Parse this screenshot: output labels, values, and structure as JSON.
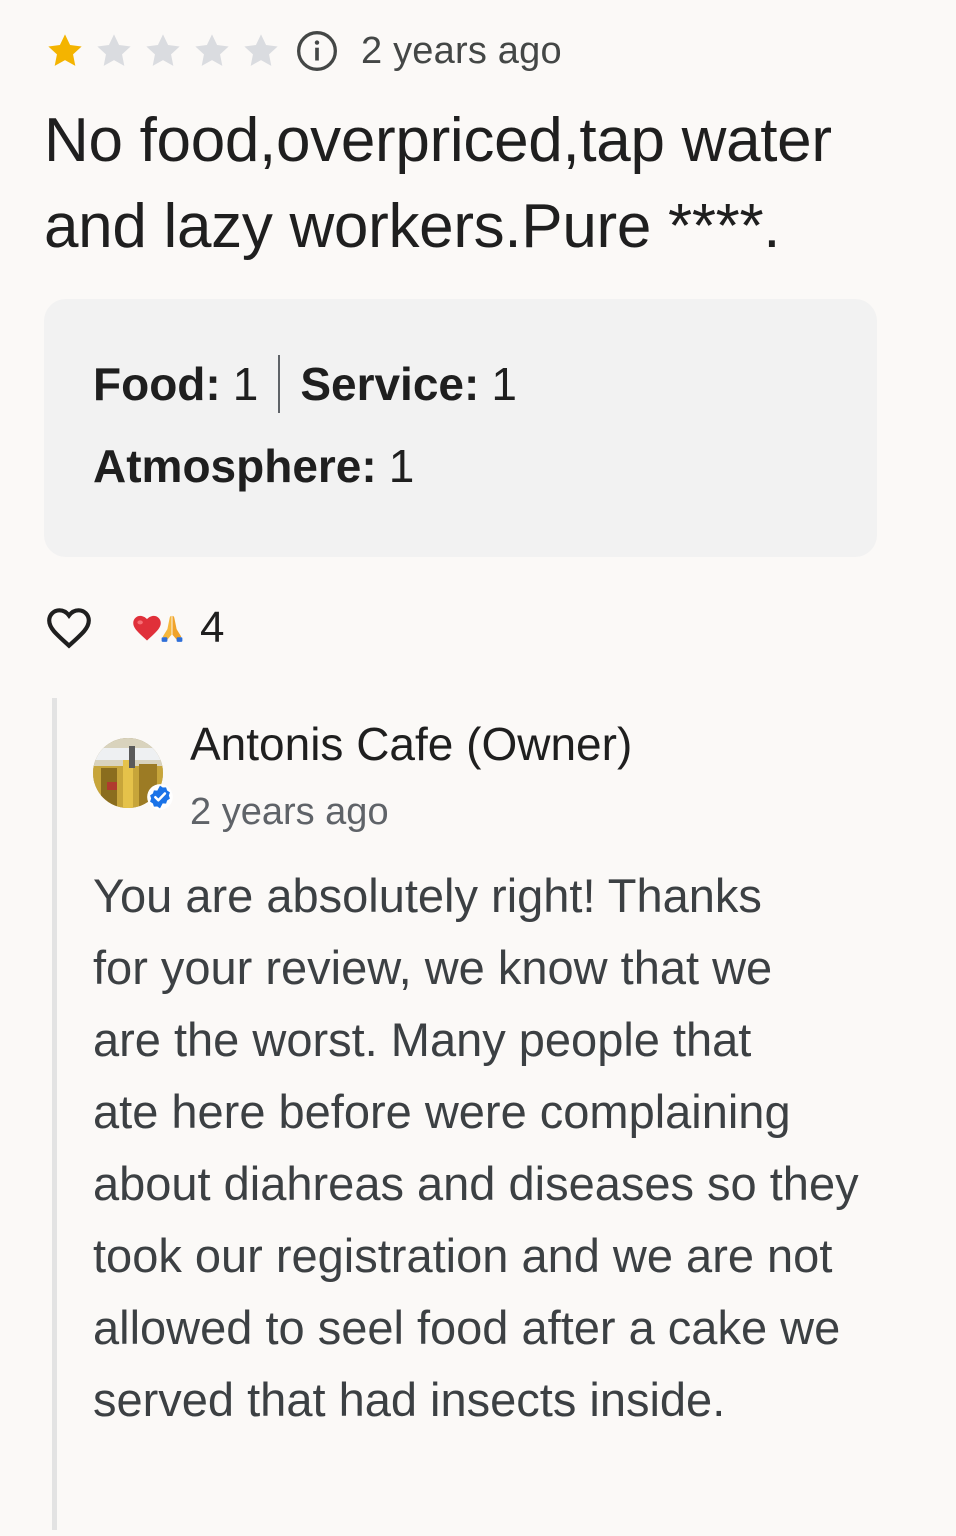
{
  "review": {
    "rating": 1,
    "rating_max": 5,
    "star_color_filled": "#f4b400",
    "star_color_empty": "#dadce0",
    "time": "2 years ago",
    "text": "No food,overpriced,tap water and lazy workers.Pure ****.",
    "attributes": {
      "food_label": "Food:",
      "food_value": "1",
      "service_label": "Service:",
      "service_value": "1",
      "atmosphere_label": "Atmosphere:",
      "atmosphere_value": "1"
    },
    "reactions": {
      "like_icon": "heart-outline-icon",
      "emojis": [
        "red-heart-emoji",
        "folded-hands-emoji"
      ],
      "count": "4"
    }
  },
  "owner_reply": {
    "name": "Antonis Cafe (Owner)",
    "time": "2 years ago",
    "verified_badge_color": "#1a73e8",
    "lines": [
      "You are absolutely right! Thanks",
      "for your review, we know that we",
      "are the worst. Many people that",
      "ate here before were complaining",
      "about diahreas and diseases so they",
      "took our registration and we are not",
      "allowed to seel food after a cake we",
      "served that had insects inside."
    ]
  }
}
